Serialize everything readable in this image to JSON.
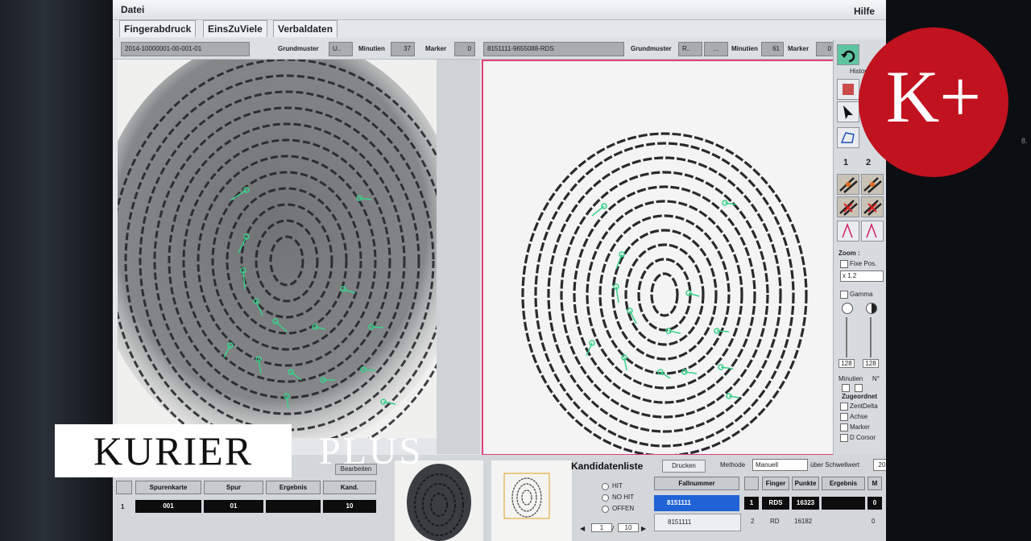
{
  "app": {
    "menu_file": "Datei",
    "menu_help": "Hilfe",
    "tabs": [
      {
        "label": "Fingerabdruck"
      },
      {
        "label": "EinsZuViele"
      },
      {
        "label": "Verbaldaten"
      }
    ]
  },
  "left_panel": {
    "id_field": "2014-10000001-00-001-01",
    "grundmuster_label": "Grundmuster",
    "grundmuster_value": "U..",
    "minutien_label": "Minutien",
    "minutien_value": "37",
    "marker_label": "Marker",
    "marker_value": "0"
  },
  "right_panel": {
    "id_field": "8151111-9655088-RDS",
    "grundmuster_label": "Grundmuster",
    "grundmuster_value": "R..",
    "grundmuster_extra": "...",
    "minutien_label": "Minutien",
    "minutien_value": "61",
    "marker_label": "Marker",
    "marker_value": "0"
  },
  "tools": {
    "history_label": "Histori",
    "num1": "1",
    "num2": "2",
    "zoom_label": "Zoom :",
    "fixe_pos_label": "Fixe Pos.",
    "zoom_value": "x 1.2",
    "gamma_label": "Gamma",
    "slider1_value": "128",
    "slider2_value": "128",
    "minutien_label": "Minutien",
    "n_label": "N°",
    "zugeordnet_label": "Zugeordnet",
    "zentdelta_label": "ZentDelta",
    "achse_label": "Achse",
    "marker_label": "Marker",
    "dcursor_label": "D Corsor"
  },
  "bottom_left": {
    "bearbeiten_label": "Bearbeiten",
    "headers": [
      "Spurenkarte",
      "Spur",
      "Ergebnis",
      "Kand."
    ],
    "row": {
      "index": "1",
      "cells": [
        "001",
        "01",
        "",
        "10"
      ]
    }
  },
  "candidates": {
    "title": "Kandidatenliste",
    "print_button": "Drucken",
    "method_label": "Methode",
    "method_value": "Manuell",
    "threshold_label": "über Schwellwert",
    "threshold_value": "20",
    "radio_options": [
      "HIT",
      "NO HIT",
      "OFFEN"
    ],
    "pager_current": "1",
    "pager_sep": "/",
    "pager_total": "10",
    "fall_header": "Fallnummer",
    "fall_rows": [
      "8151111",
      "8151111"
    ],
    "detail_headers": [
      "Finger",
      "Punkte",
      "Ergebnis",
      "M"
    ],
    "detail_rows": [
      {
        "index": "1",
        "finger": "RDS",
        "punkte": "16323",
        "ergebnis": "",
        "m": "0"
      },
      {
        "index": "2",
        "finger": "RD",
        "punkte": "16182",
        "ergebnis": "",
        "m": "0"
      }
    ]
  },
  "overlay": {
    "badge_text": "K+",
    "kurier_text": "KURIER",
    "plus_text": "PLUS"
  },
  "side_text": "8.",
  "colors": {
    "badge_red": "#c1121f",
    "panel_border_pink": "#e0407a",
    "marker_green": "#38d08a",
    "selection_blue": "#1f63d6"
  }
}
